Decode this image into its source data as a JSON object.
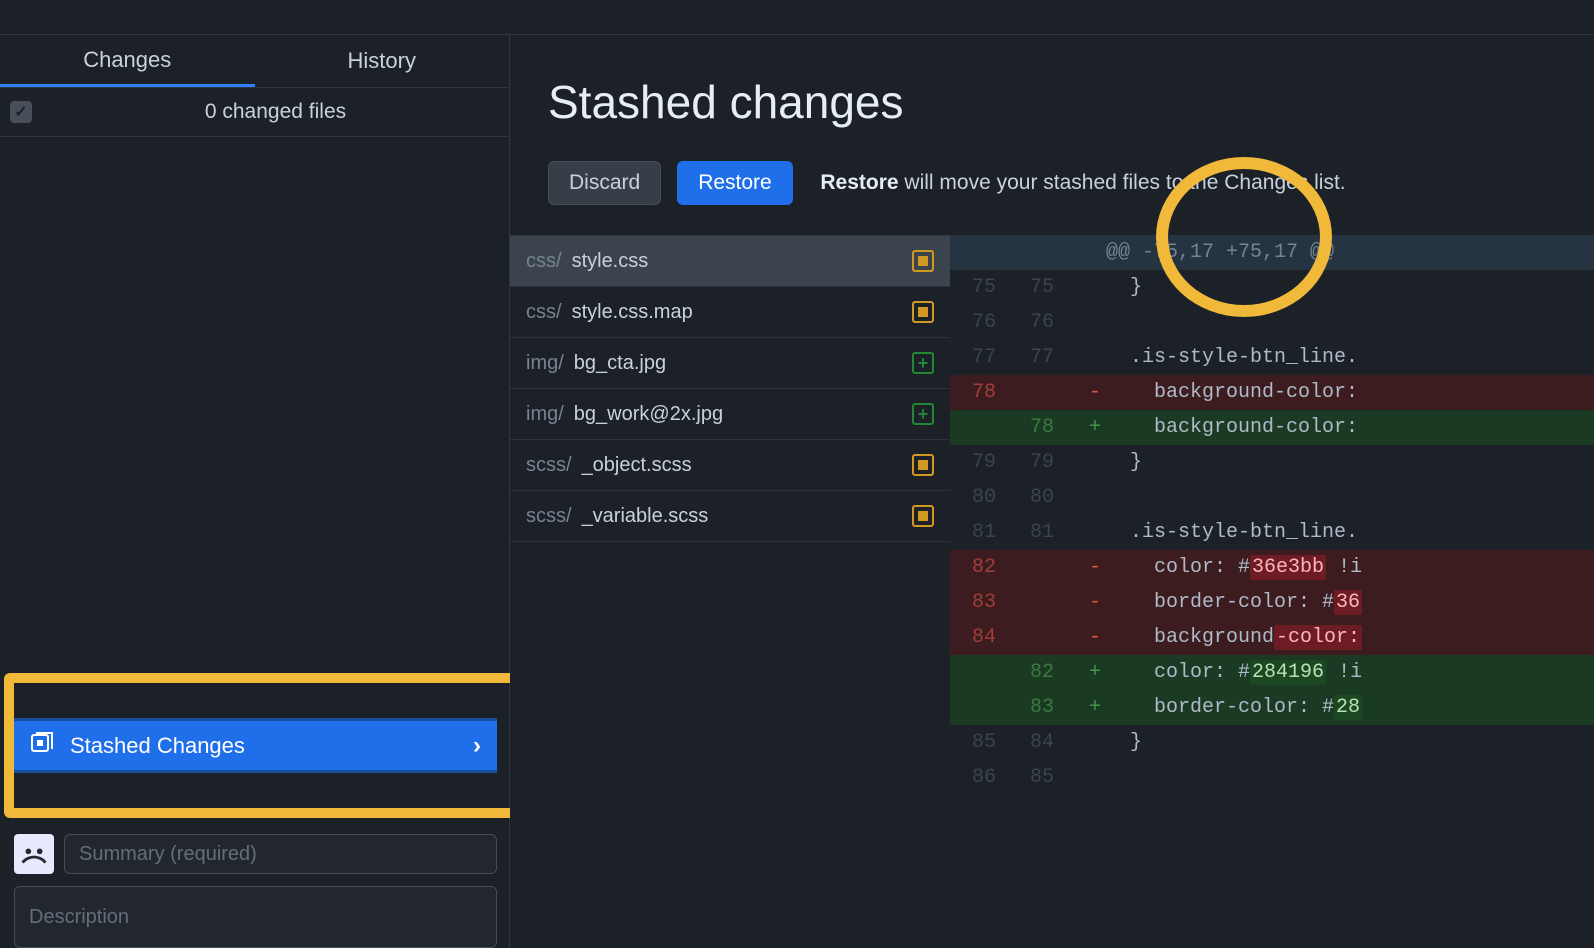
{
  "tabs": {
    "changes": "Changes",
    "history": "History"
  },
  "filebar": {
    "count_label": "0 changed files"
  },
  "stash_row": {
    "label": "Stashed Changes"
  },
  "commit": {
    "summary_placeholder": "Summary (required)",
    "description_placeholder": "Description"
  },
  "header": {
    "title": "Stashed changes",
    "discard": "Discard",
    "restore": "Restore",
    "hint_bold": "Restore",
    "hint_rest": " will move your stashed files to the Changes list."
  },
  "stashed_files": [
    {
      "dir": "css/",
      "name": "style.css",
      "status": "modified",
      "selected": true
    },
    {
      "dir": "css/",
      "name": "style.css.map",
      "status": "modified",
      "selected": false
    },
    {
      "dir": "img/",
      "name": "bg_cta.jpg",
      "status": "added",
      "selected": false
    },
    {
      "dir": "img/",
      "name": "bg_work@2x.jpg",
      "status": "added",
      "selected": false
    },
    {
      "dir": "scss/",
      "name": "_object.scss",
      "status": "modified",
      "selected": false
    },
    {
      "dir": "scss/",
      "name": "_variable.scss",
      "status": "modified",
      "selected": false
    }
  ],
  "diff": {
    "hunk": "@@ -75,17 +75,17 @@",
    "lines": [
      {
        "l": "75",
        "r": "75",
        "t": "ctx",
        "code": "  }"
      },
      {
        "l": "76",
        "r": "76",
        "t": "ctx",
        "code": ""
      },
      {
        "l": "77",
        "r": "77",
        "t": "ctx",
        "code": "  .is-style-btn_line."
      },
      {
        "l": "78",
        "r": "",
        "t": "del",
        "code": "    background-color:"
      },
      {
        "l": "",
        "r": "78",
        "t": "add",
        "code": "    background-color:"
      },
      {
        "l": "79",
        "r": "79",
        "t": "ctx",
        "code": "  }"
      },
      {
        "l": "80",
        "r": "80",
        "t": "ctx",
        "code": ""
      },
      {
        "l": "81",
        "r": "81",
        "t": "ctx",
        "code": "  .is-style-btn_line."
      },
      {
        "l": "82",
        "r": "",
        "t": "del",
        "code_html": "    <span class='plain'>color: #</span><span class='hl-red'>36e3bb</span> <span class='plain'>!i</span>"
      },
      {
        "l": "83",
        "r": "",
        "t": "del",
        "code_html": "    <span class='plain'>border-color: #</span><span class='hl-red'>36</span>"
      },
      {
        "l": "84",
        "r": "",
        "t": "del",
        "code_html": "    <span class='plain'>background</span><span class='hl-red'>-color:</span>"
      },
      {
        "l": "",
        "r": "82",
        "t": "add",
        "code_html": "    <span class='plain'>color: #</span><span class='hl-green'>284196</span> <span class='plain'>!i</span>"
      },
      {
        "l": "",
        "r": "83",
        "t": "add",
        "code_html": "    <span class='plain'>border-color: #</span><span class='hl-green'>28</span>"
      },
      {
        "l": "85",
        "r": "84",
        "t": "ctx",
        "code": "  }"
      },
      {
        "l": "86",
        "r": "85",
        "t": "ctx",
        "code": ""
      }
    ]
  }
}
